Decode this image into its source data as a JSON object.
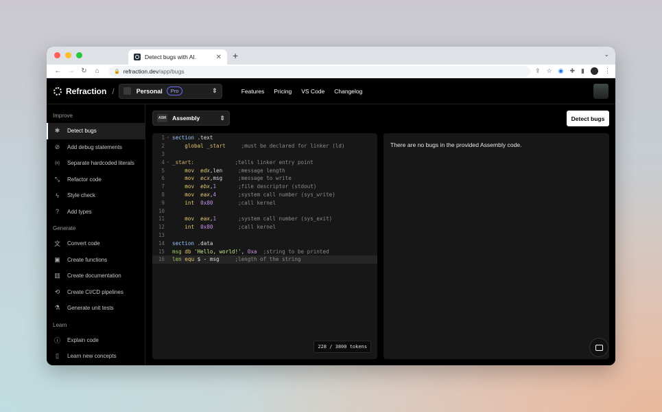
{
  "browser": {
    "tab_title": "Detect bugs with AI.",
    "url_host": "refraction.dev",
    "url_path": "/app/bugs"
  },
  "header": {
    "brand": "Refraction",
    "separator": "/",
    "workspace": "Personal",
    "plan_badge": "Pro",
    "nav": [
      "Features",
      "Pricing",
      "VS Code",
      "Changelog"
    ]
  },
  "sidebar": {
    "sections": [
      {
        "title": "Improve",
        "items": [
          {
            "label": "Detect bugs",
            "icon": "bug-icon",
            "active": true
          },
          {
            "label": "Add debug statements",
            "icon": "debug-icon"
          },
          {
            "label": "Separate hardcoded literals",
            "icon": "variable-icon"
          },
          {
            "label": "Refactor code",
            "icon": "shrink-icon"
          },
          {
            "label": "Style check",
            "icon": "lightning-icon"
          },
          {
            "label": "Add types",
            "icon": "question-circle-icon"
          }
        ]
      },
      {
        "title": "Generate",
        "items": [
          {
            "label": "Convert code",
            "icon": "translate-icon"
          },
          {
            "label": "Create functions",
            "icon": "package-icon"
          },
          {
            "label": "Create documentation",
            "icon": "book-icon"
          },
          {
            "label": "Create CI/CD pipelines",
            "icon": "pipeline-icon"
          },
          {
            "label": "Generate unit tests",
            "icon": "flask-icon"
          }
        ]
      },
      {
        "title": "Learn",
        "items": [
          {
            "label": "Explain code",
            "icon": "info-icon"
          },
          {
            "label": "Learn new concepts",
            "icon": "bookmark-icon"
          }
        ]
      }
    ]
  },
  "toolbar": {
    "language_badge": "ASM",
    "language": "Assembly",
    "detect_label": "Detect bugs"
  },
  "editor": {
    "lines": [
      {
        "n": "1",
        "fold": true,
        "html": "<span class='k'>section</span> .text"
      },
      {
        "n": "2",
        "html": "    <span class='kw'>global</span> <span class='lbl'>_start</span>     <span class='c'>;must be declared for linker (ld)</span>"
      },
      {
        "n": "3",
        "html": ""
      },
      {
        "n": "4",
        "fold": true,
        "html": "<span class='lbl'>_start:</span>             <span class='c'>;tells linker entry point</span>"
      },
      {
        "n": "5",
        "html": "    <span class='kw'>mov</span>  <span class='r'>edx</span>,len     <span class='c'>;message length</span>"
      },
      {
        "n": "6",
        "html": "    <span class='kw'>mov</span>  <span class='r'>ecx</span>,msg     <span class='c'>;message to write</span>"
      },
      {
        "n": "7",
        "html": "    <span class='kw'>mov</span>  <span class='r'>ebx</span>,<span class='n'>1</span>       <span class='c'>;file descriptor (stdout)</span>"
      },
      {
        "n": "8",
        "html": "    <span class='kw'>mov</span>  <span class='r'>eax</span>,<span class='n'>4</span>       <span class='c'>;system call number (sys_write)</span>"
      },
      {
        "n": "9",
        "html": "    <span class='kw'>int</span>  <span class='n'>0x80</span>        <span class='c'>;call kernel</span>"
      },
      {
        "n": "10",
        "html": ""
      },
      {
        "n": "11",
        "html": "    <span class='kw'>mov</span>  <span class='r'>eax</span>,<span class='n'>1</span>       <span class='c'>;system call number (sys_exit)</span>"
      },
      {
        "n": "12",
        "html": "    <span class='kw'>int</span>  <span class='n'>0x80</span>        <span class='c'>;call kernel</span>"
      },
      {
        "n": "13",
        "html": ""
      },
      {
        "n": "14",
        "html": "<span class='k'>section</span> .data"
      },
      {
        "n": "15",
        "html": "<span class='g'>msg</span> <span class='kw'>db</span> <span class='s'>'Hello, world!'</span>, <span class='n'>0xa</span>  <span class='c'>;string to be printed</span>"
      },
      {
        "n": "16",
        "current": true,
        "html": "<span class='g'>len</span> <span class='kw'>equ</span> $ - msg     <span class='c'>;length of the string</span>"
      }
    ],
    "token_count": "228 / 3800 tokens"
  },
  "result": {
    "message": "There are no bugs in the provided Assembly code."
  },
  "colors": {
    "accent": "#6b6ef7",
    "background": "#000000",
    "panel": "#171717"
  }
}
